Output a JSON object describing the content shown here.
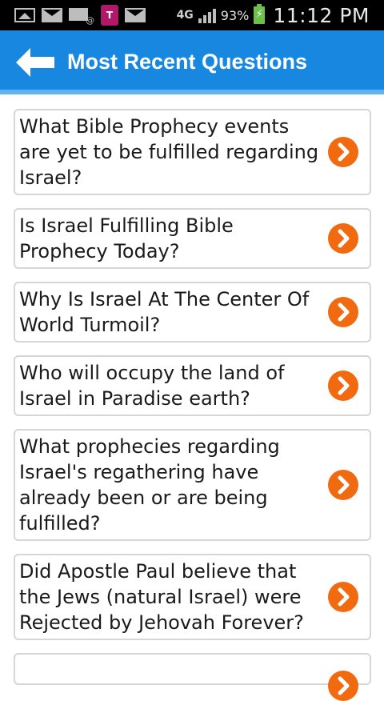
{
  "status_bar": {
    "icons": [
      "image-icon",
      "mail-icon",
      "mail-at-icon",
      "tmobile-app-icon",
      "mail-icon"
    ],
    "network_type": "4G",
    "battery_percent": "93%",
    "time": "11:12 PM"
  },
  "header": {
    "title": "Most Recent Questions",
    "back_icon": "arrow-left-icon",
    "background_color": "#1787e0"
  },
  "questions": [
    {
      "text": "What Bible Prophecy events are yet to be fulfilled regarding Israel?"
    },
    {
      "text": "Is Israel Fulfilling Bible Prophecy Today?"
    },
    {
      "text": "Why Is Israel At The Center Of World Turmoil?"
    },
    {
      "text": "Who will occupy the land of Israel in Paradise earth?"
    },
    {
      "text": "What prophecies regarding Israel's regathering have already been or are being fulfilled?"
    },
    {
      "text": "Did Apostle Paul believe that the Jews (natural Israel) were Rejected by Jehovah Forever?"
    },
    {
      "text": ""
    }
  ],
  "chevron_color": "#f26a10"
}
